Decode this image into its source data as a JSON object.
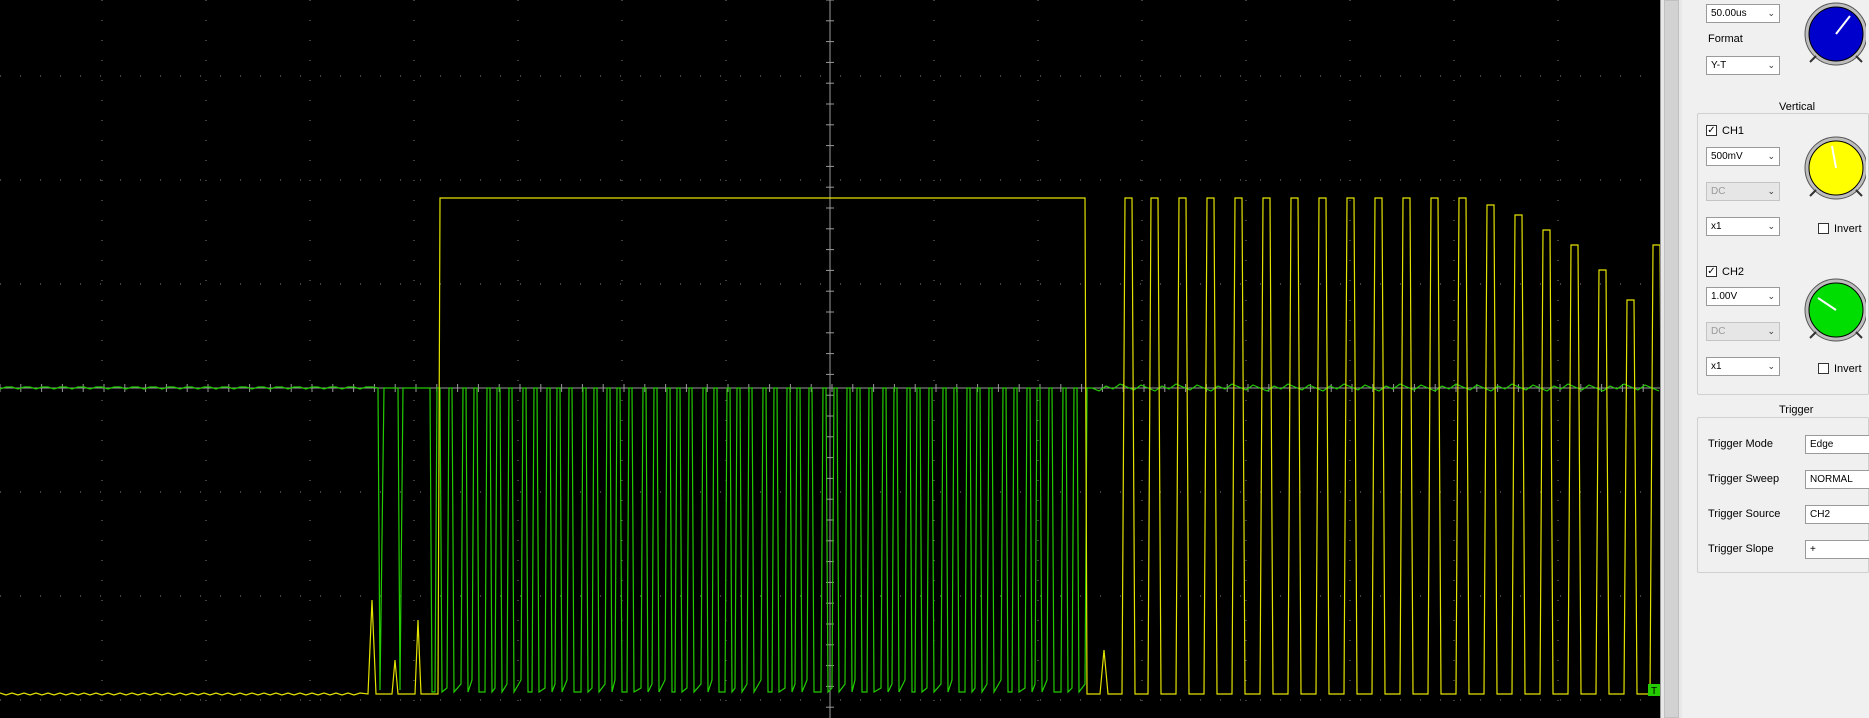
{
  "timebase": {
    "value": "50.00us",
    "format_label": "Format",
    "format_value": "Y-T"
  },
  "vertical": {
    "title": "Vertical",
    "ch1": {
      "label": "CH1",
      "checked": true,
      "volts": "500mV",
      "coupling": "DC",
      "probe": "x1",
      "invert_label": "Invert",
      "color": "#ffff00"
    },
    "ch2": {
      "label": "CH2",
      "checked": true,
      "volts": "1.00V",
      "coupling": "DC",
      "probe": "x1",
      "invert_label": "Invert",
      "color": "#00dd00"
    }
  },
  "trigger": {
    "title": "Trigger",
    "rows": [
      {
        "label": "Trigger Mode",
        "value": "Edge"
      },
      {
        "label": "Trigger Sweep",
        "value": "NORMAL"
      },
      {
        "label": "Trigger Source",
        "value": "CH2"
      },
      {
        "label": "Trigger Slope",
        "value": "+"
      }
    ]
  },
  "scope": {
    "background": "#000000",
    "grid_color": "#7f7f7f",
    "trigger_marker": "T",
    "trace_colors": {
      "ch1": "#e3e300",
      "ch2": "#22cc00"
    }
  },
  "knob_colors": {
    "timebase": "#0000cc",
    "ch1": "#ffff00",
    "ch2": "#00dd00"
  }
}
